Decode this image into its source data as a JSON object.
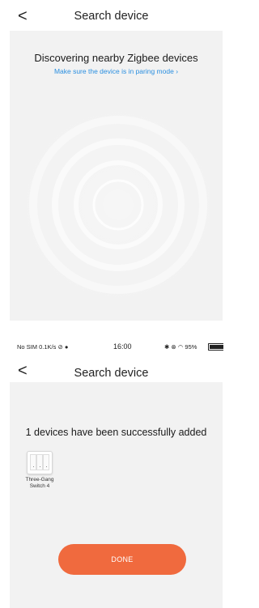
{
  "screen1": {
    "header": {
      "back_glyph": "<",
      "title": "Search device"
    },
    "discover_title": "Discovering nearby Zigbee devices",
    "discover_hint": "Make sure the device is in paring mode",
    "hint_arrow": "›"
  },
  "statusbar": {
    "carrier": "No SIM 0.1K/s",
    "time": "16:00",
    "right_status": "95%"
  },
  "screen2": {
    "header": {
      "back_glyph": "<",
      "title": "Search device"
    },
    "success_text": "1 devices have been successfully added",
    "devices": [
      {
        "name_line1": "Three-Gang",
        "name_line2": "Switch 4",
        "icon": "three-gang-switch-icon"
      }
    ],
    "done_label": "DONE"
  },
  "colors": {
    "panel_bg": "#f2f2f2",
    "accent_link": "#2a8fe0",
    "button_orange": "#f06a3e"
  }
}
